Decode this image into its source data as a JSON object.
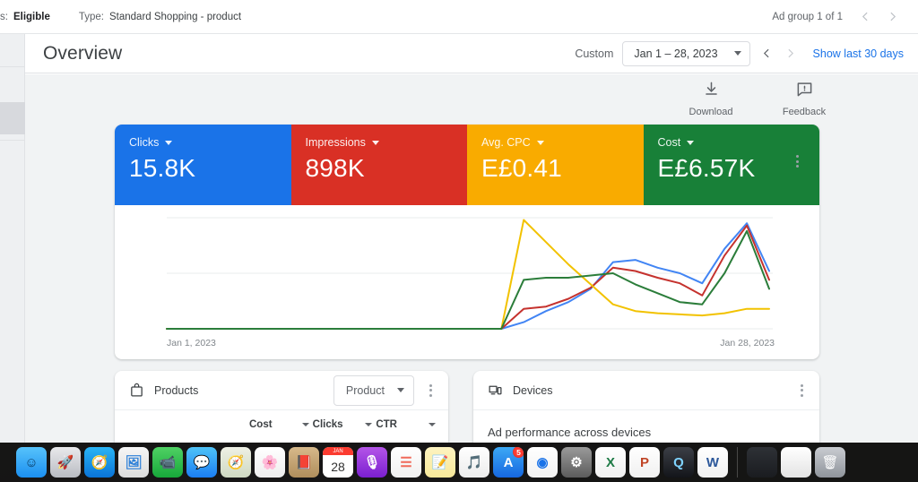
{
  "top_strip": {
    "status_label": "s:",
    "status_value": "Eligible",
    "type_label": "Type:",
    "type_value": "Standard Shopping - product",
    "ad_group_counter": "Ad group 1 of 1",
    "prev_icon": "chevron-left-icon",
    "next_icon": "chevron-right-icon"
  },
  "page_header": {
    "title": "Overview",
    "custom_label": "Custom",
    "date_range": "Jan 1 – 28, 2023",
    "date_caret_icon": "chevron-down-icon",
    "prev_period_icon": "chevron-left-icon",
    "next_period_icon": "chevron-right-icon",
    "show_last_30": "Show last 30 days"
  },
  "actions": [
    {
      "label": "Download",
      "icon": "download-icon"
    },
    {
      "label": "Feedback",
      "icon": "feedback-icon"
    }
  ],
  "metrics": {
    "menu_icon": "more-vert-icon",
    "tiles": [
      {
        "name": "Clicks",
        "value": "15.8K",
        "color": "#1a73e8",
        "caret_icon": "chevron-down-icon"
      },
      {
        "name": "Impressions",
        "value": "898K",
        "color": "#d93025",
        "caret_icon": "chevron-down-icon"
      },
      {
        "name": "Avg. CPC",
        "value": "E£0.41",
        "color": "#f9ab00",
        "caret_icon": "chevron-down-icon"
      },
      {
        "name": "Cost",
        "value": "E£6.57K",
        "color": "#188038",
        "caret_icon": "chevron-down-icon"
      }
    ]
  },
  "chart_data": {
    "type": "line",
    "title": "",
    "xlabel": "",
    "ylabel": "",
    "grid": true,
    "legend_position": "none",
    "x_tick_labels": [
      "Jan 1, 2023",
      "Jan 28, 2023"
    ],
    "x": [
      "Jan 1",
      "Jan 2",
      "Jan 3",
      "Jan 4",
      "Jan 5",
      "Jan 6",
      "Jan 7",
      "Jan 8",
      "Jan 9",
      "Jan 10",
      "Jan 11",
      "Jan 12",
      "Jan 13",
      "Jan 14",
      "Jan 15",
      "Jan 16",
      "Jan 17",
      "Jan 18",
      "Jan 19",
      "Jan 20",
      "Jan 21",
      "Jan 22",
      "Jan 23",
      "Jan 24",
      "Jan 25",
      "Jan 26",
      "Jan 27",
      "Jan 28"
    ],
    "ylim": [
      0,
      100
    ],
    "series": [
      {
        "name": "Clicks",
        "color": "#4285f4",
        "values": [
          0,
          0,
          0,
          0,
          0,
          0,
          0,
          0,
          0,
          0,
          0,
          0,
          0,
          0,
          0,
          0,
          6,
          16,
          24,
          36,
          60,
          62,
          55,
          50,
          41,
          72,
          95,
          52
        ]
      },
      {
        "name": "Impressions",
        "color": "#c5322e",
        "values": [
          0,
          0,
          0,
          0,
          0,
          0,
          0,
          0,
          0,
          0,
          0,
          0,
          0,
          0,
          0,
          0,
          18,
          20,
          27,
          37,
          55,
          52,
          46,
          41,
          30,
          66,
          93,
          44
        ]
      },
      {
        "name": "Avg. CPC",
        "color": "#f2c200",
        "values": [
          0,
          0,
          0,
          0,
          0,
          0,
          0,
          0,
          0,
          0,
          0,
          0,
          0,
          0,
          0,
          0,
          98,
          78,
          58,
          40,
          22,
          16,
          14,
          13,
          12,
          14,
          18,
          18
        ]
      },
      {
        "name": "Cost",
        "color": "#2b7d3a",
        "values": [
          0,
          0,
          0,
          0,
          0,
          0,
          0,
          0,
          0,
          0,
          0,
          0,
          0,
          0,
          0,
          0,
          44,
          46,
          46,
          48,
          50,
          40,
          32,
          24,
          22,
          50,
          88,
          36
        ]
      }
    ]
  },
  "panels": {
    "products": {
      "title": "Products",
      "icon": "shopping-bag-icon",
      "segment_label": "Product",
      "segment_caret_icon": "chevron-down-icon",
      "menu_icon": "more-vert-icon",
      "columns": [
        "Cost",
        "Clicks",
        "CTR"
      ],
      "column_caret_icon": "chevron-down-icon"
    },
    "devices": {
      "title": "Devices",
      "icon": "devices-icon",
      "menu_icon": "more-vert-icon",
      "body_text": "Ad performance across devices"
    }
  },
  "dock": {
    "items": [
      {
        "name": "finder",
        "label": "Finder",
        "running": true
      },
      {
        "name": "launchpad",
        "label": "Launchpad",
        "running": false
      },
      {
        "name": "safari",
        "label": "Safari",
        "running": false
      },
      {
        "name": "preview",
        "label": "Preview",
        "running": false
      },
      {
        "name": "facetime",
        "label": "FaceTime",
        "running": false
      },
      {
        "name": "messages",
        "label": "Messages",
        "running": false
      },
      {
        "name": "maps",
        "label": "Maps",
        "running": false
      },
      {
        "name": "photos",
        "label": "Photos",
        "running": false
      },
      {
        "name": "contacts",
        "label": "Contacts",
        "running": false
      },
      {
        "name": "calendar",
        "label": "Calendar",
        "running": false,
        "month": "JAN",
        "day": "28"
      },
      {
        "name": "podcasts",
        "label": "Podcasts",
        "running": false
      },
      {
        "name": "reminders",
        "label": "Reminders",
        "running": false
      },
      {
        "name": "notes",
        "label": "Notes",
        "running": false
      },
      {
        "name": "itunes",
        "label": "iTunes",
        "running": false
      },
      {
        "name": "app-store",
        "label": "App Store",
        "running": false,
        "badge": "5"
      },
      {
        "name": "chrome",
        "label": "Google Chrome",
        "running": true
      },
      {
        "name": "system-prefs",
        "label": "System Preferences",
        "running": false
      },
      {
        "name": "excel",
        "label": "Microsoft Excel",
        "running": true
      },
      {
        "name": "powerpoint",
        "label": "Microsoft PowerPoint",
        "running": true
      },
      {
        "name": "quicktime",
        "label": "QuickTime Player",
        "running": true
      },
      {
        "name": "word",
        "label": "Microsoft Word",
        "running": true
      }
    ],
    "minimized": [
      {
        "name": "minimized-terminal-window",
        "label": "Terminal window"
      },
      {
        "name": "minimized-spreadsheet-window",
        "label": "Spreadsheet window"
      }
    ],
    "trash": {
      "name": "trash",
      "label": "Trash"
    }
  }
}
